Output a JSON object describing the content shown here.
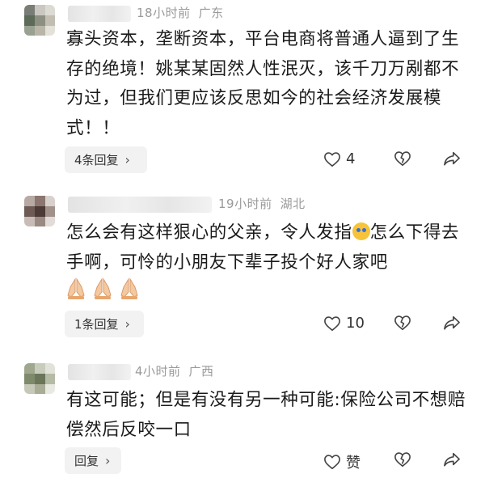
{
  "comments": [
    {
      "time": "18小时前",
      "location": "广东",
      "text": "寡头资本，垄断资本，平台电商将普通人逼到了生存的绝境！姚某某固然人性泯灭，该千刀万剐都不为过，但我们更应该反思如今的社会经济发展模式！！",
      "text_suffix": "",
      "reply_label": "4条回复",
      "like_count": "4",
      "like_icon": "heart-icon",
      "dislike_icon": "broken-heart-icon",
      "share_icon": "share-arrow-icon"
    },
    {
      "time": "19小时前",
      "location": "湖北",
      "text": "怎么会有这样狠心的父亲，令人发指",
      "text_suffix": "怎么下得去手啊，可怜的小朋友下辈子投个好人家吧",
      "emoji_inline": "crying-face-emoji",
      "emoji_row": [
        "praying-hands-emoji",
        "praying-hands-emoji",
        "praying-hands-emoji"
      ],
      "reply_label": "1条回复",
      "like_count": "10",
      "like_icon": "heart-icon",
      "dislike_icon": "broken-heart-icon",
      "share_icon": "share-arrow-icon"
    },
    {
      "time": "4小时前",
      "location": "广西",
      "text": "有这可能；但是有没有另一种可能:保险公司不想赔偿然后反咬一口",
      "text_suffix": "",
      "reply_label": "回复",
      "like_count": "赞",
      "like_icon": "heart-icon",
      "dislike_icon": "broken-heart-icon",
      "share_icon": "share-arrow-icon"
    }
  ],
  "colors": {
    "meta_text": "#9a9a9a",
    "reply_bg": "#f2f2f2",
    "body_text": "#1a1a1a"
  }
}
